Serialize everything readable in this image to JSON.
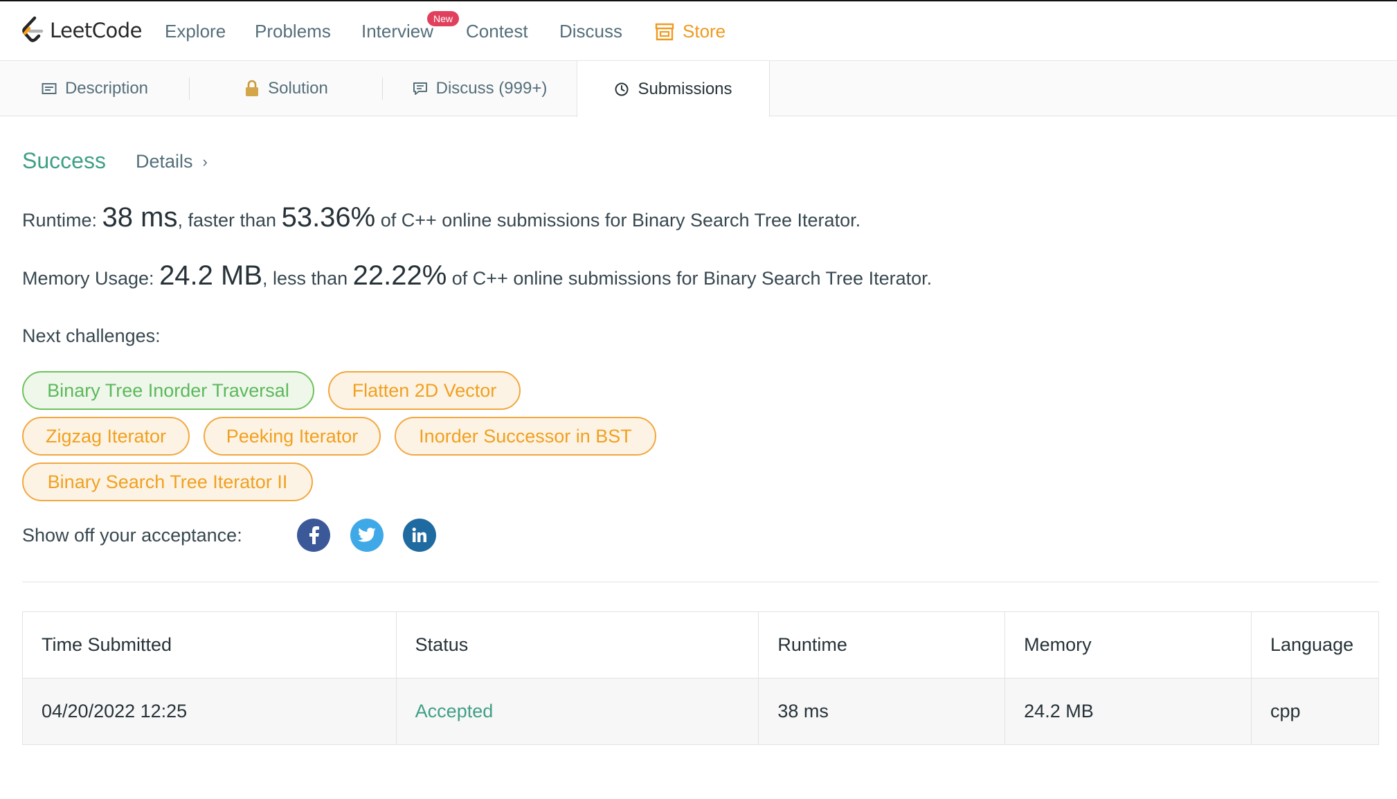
{
  "nav": {
    "logo_text": "LeetCode",
    "items": [
      "Explore",
      "Problems",
      "Interview",
      "Contest",
      "Discuss"
    ],
    "new_badge": "New",
    "store": "Store",
    "store_color": "#ef9a1f"
  },
  "tabs": [
    {
      "label": "Description",
      "icon": "description-icon"
    },
    {
      "label": "Solution",
      "icon": "lock-icon"
    },
    {
      "label": "Discuss (999+)",
      "icon": "comment-icon"
    },
    {
      "label": "Submissions",
      "icon": "clock-icon",
      "active": true
    }
  ],
  "result": {
    "status": "Success",
    "status_color": "#3f9f86",
    "details": "Details",
    "runtime": {
      "label": "Runtime: ",
      "value": "38 ms",
      "mid": ", faster than ",
      "percent": "53.36%",
      "suffix": " of C++ online submissions for Binary Search Tree Iterator."
    },
    "memory": {
      "label": "Memory Usage: ",
      "value": "24.2 MB",
      "mid": ", less than ",
      "percent": "22.22%",
      "suffix": " of C++ online submissions for Binary Search Tree Iterator."
    }
  },
  "next_challenges": {
    "label": "Next challenges:",
    "items": [
      {
        "label": "Binary Tree Inorder Traversal",
        "difficulty": "easy"
      },
      {
        "label": "Flatten 2D Vector",
        "difficulty": "medium"
      },
      {
        "label": "Zigzag Iterator",
        "difficulty": "medium"
      },
      {
        "label": "Peeking Iterator",
        "difficulty": "medium"
      },
      {
        "label": "Inorder Successor in BST",
        "difficulty": "medium"
      },
      {
        "label": "Binary Search Tree Iterator II",
        "difficulty": "medium"
      }
    ]
  },
  "share": {
    "label": "Show off your acceptance:",
    "icons": [
      "facebook-icon",
      "twitter-icon",
      "linkedin-icon"
    ]
  },
  "submissions": {
    "headers": [
      "Time Submitted",
      "Status",
      "Runtime",
      "Memory",
      "Language"
    ],
    "rows": [
      {
        "time": "04/20/2022 12:25",
        "status": "Accepted",
        "runtime": "38 ms",
        "memory": "24.2 MB",
        "language": "cpp"
      }
    ]
  }
}
